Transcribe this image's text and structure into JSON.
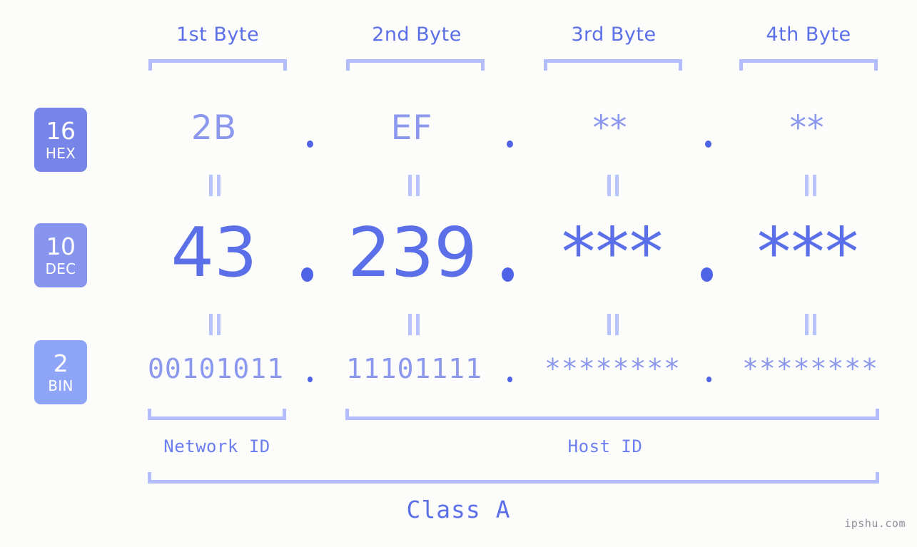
{
  "meta": {
    "background_color": "#fcfdfa",
    "accent_dark": "#5b6fe8",
    "accent_mid": "#8b98ee",
    "accent_light": "#b3bdfb",
    "badge_hex_color": "#7885e8",
    "badge_dec_color": "#8795ef",
    "badge_bin_color": "#8ea5f7",
    "dot_color": "#4f63e6",
    "watermark": "ipshu.com"
  },
  "byte_headers": [
    {
      "label": "1st Byte"
    },
    {
      "label": "2nd Byte"
    },
    {
      "label": "3rd Byte"
    },
    {
      "label": "4th Byte"
    }
  ],
  "bases": [
    {
      "num": "16",
      "name": "HEX"
    },
    {
      "num": "10",
      "name": "DEC"
    },
    {
      "num": "2",
      "name": "BIN"
    }
  ],
  "rows": {
    "hex": {
      "base_num": "16",
      "base_name": "HEX",
      "values": [
        "2B",
        "EF",
        "**",
        "**"
      ]
    },
    "dec": {
      "base_num": "10",
      "base_name": "DEC",
      "values": [
        "43",
        "239",
        "***",
        "***"
      ]
    },
    "bin": {
      "base_num": "2",
      "base_name": "BIN",
      "values": [
        "00101011",
        "11101111",
        "********",
        "********"
      ]
    }
  },
  "separators": {
    "symbol": "."
  },
  "equality": {
    "symbol": "="
  },
  "segments": {
    "network_id": "Network ID",
    "host_id": "Host ID"
  },
  "class": {
    "label": "Class A"
  }
}
